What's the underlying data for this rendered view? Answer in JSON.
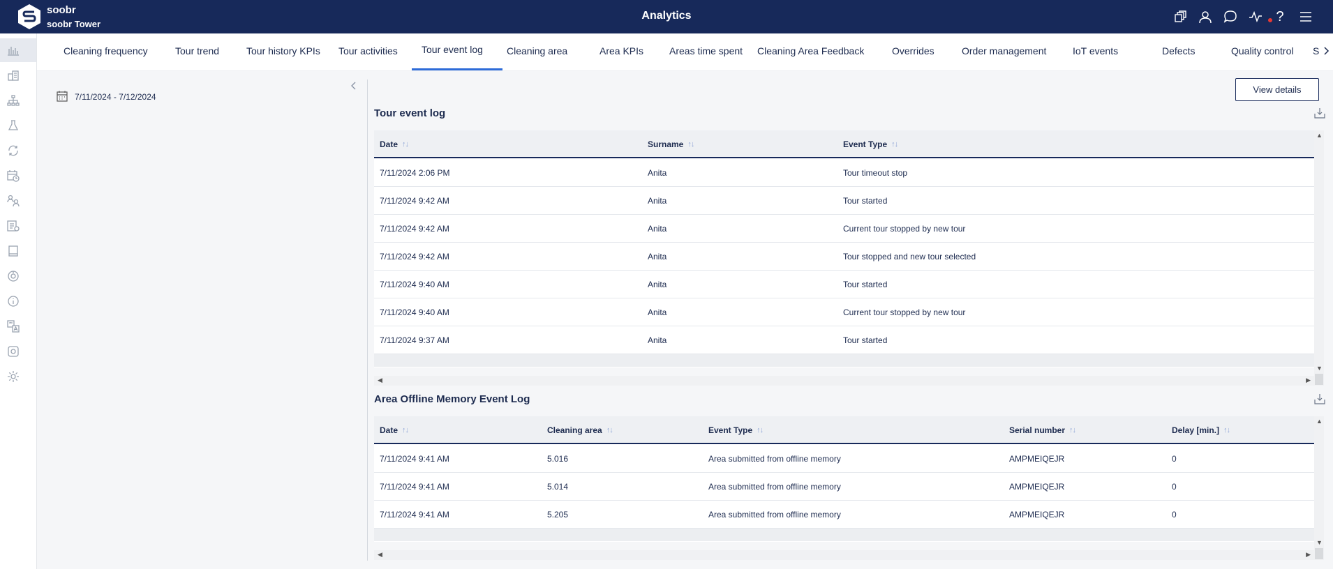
{
  "header": {
    "brand_name": "soobr",
    "site_name": "soobr Tower",
    "title": "Analytics",
    "icons": [
      "copy-icon",
      "user-icon",
      "chat-icon",
      "activity-icon",
      "help-icon",
      "menu-icon"
    ],
    "help_glyph": "?",
    "bg_color": "#17295a",
    "alert_color": "#e53935"
  },
  "rail": {
    "icons": [
      "analytics-icon",
      "buildings-icon",
      "hierarchy-icon",
      "lab-icon",
      "refresh-icon",
      "calendar-clock-icon",
      "user-swap-icon",
      "list-icon",
      "tablet-icon",
      "sensor-icon",
      "info-icon",
      "translate-icon",
      "settings-cog-icon",
      "settings-icon"
    ]
  },
  "tabs": {
    "items": [
      {
        "label": "Cleaning frequency"
      },
      {
        "label": "Tour trend"
      },
      {
        "label": "Tour history KPIs"
      },
      {
        "label": "Tour activities"
      },
      {
        "label": "Tour event log"
      },
      {
        "label": "Cleaning area"
      },
      {
        "label": "Area KPIs"
      },
      {
        "label": "Areas time spent"
      },
      {
        "label": "Cleaning Area Feedback"
      },
      {
        "label": "Overrides"
      },
      {
        "label": "Order management"
      },
      {
        "label": "IoT events"
      },
      {
        "label": "Defects"
      },
      {
        "label": "Quality control"
      },
      {
        "label": "S"
      }
    ],
    "active_index": 4,
    "accent_color": "#2d6bd8"
  },
  "filter": {
    "date_range": "7/11/2024 - 7/12/2024"
  },
  "actions": {
    "view_details_label": "View details"
  },
  "tour_log": {
    "title": "Tour event log",
    "columns": [
      "Date",
      "Surname",
      "Event Type"
    ],
    "rows": [
      [
        "7/11/2024 2:06 PM",
        "Anita",
        "Tour timeout stop"
      ],
      [
        "7/11/2024 9:42 AM",
        "Anita",
        "Tour started"
      ],
      [
        "7/11/2024 9:42 AM",
        "Anita",
        "Current tour stopped by new tour"
      ],
      [
        "7/11/2024 9:42 AM",
        "Anita",
        "Tour stopped and new tour selected"
      ],
      [
        "7/11/2024 9:40 AM",
        "Anita",
        "Tour started"
      ],
      [
        "7/11/2024 9:40 AM",
        "Anita",
        "Current tour stopped by new tour"
      ],
      [
        "7/11/2024 9:37 AM",
        "Anita",
        "Tour started"
      ]
    ]
  },
  "offline_log": {
    "title": "Area Offline Memory Event Log",
    "columns": [
      "Date",
      "Cleaning area",
      "Event Type",
      "Serial number",
      "Delay [min.]"
    ],
    "rows": [
      [
        "7/11/2024 9:41 AM",
        "5.016",
        "Area submitted from offline memory",
        "AMPMEIQEJR",
        "0"
      ],
      [
        "7/11/2024 9:41 AM",
        "5.014",
        "Area submitted from offline memory",
        "AMPMEIQEJR",
        "0"
      ],
      [
        "7/11/2024 9:41 AM",
        "5.205",
        "Area submitted from offline memory",
        "AMPMEIQEJR",
        "0"
      ]
    ]
  }
}
